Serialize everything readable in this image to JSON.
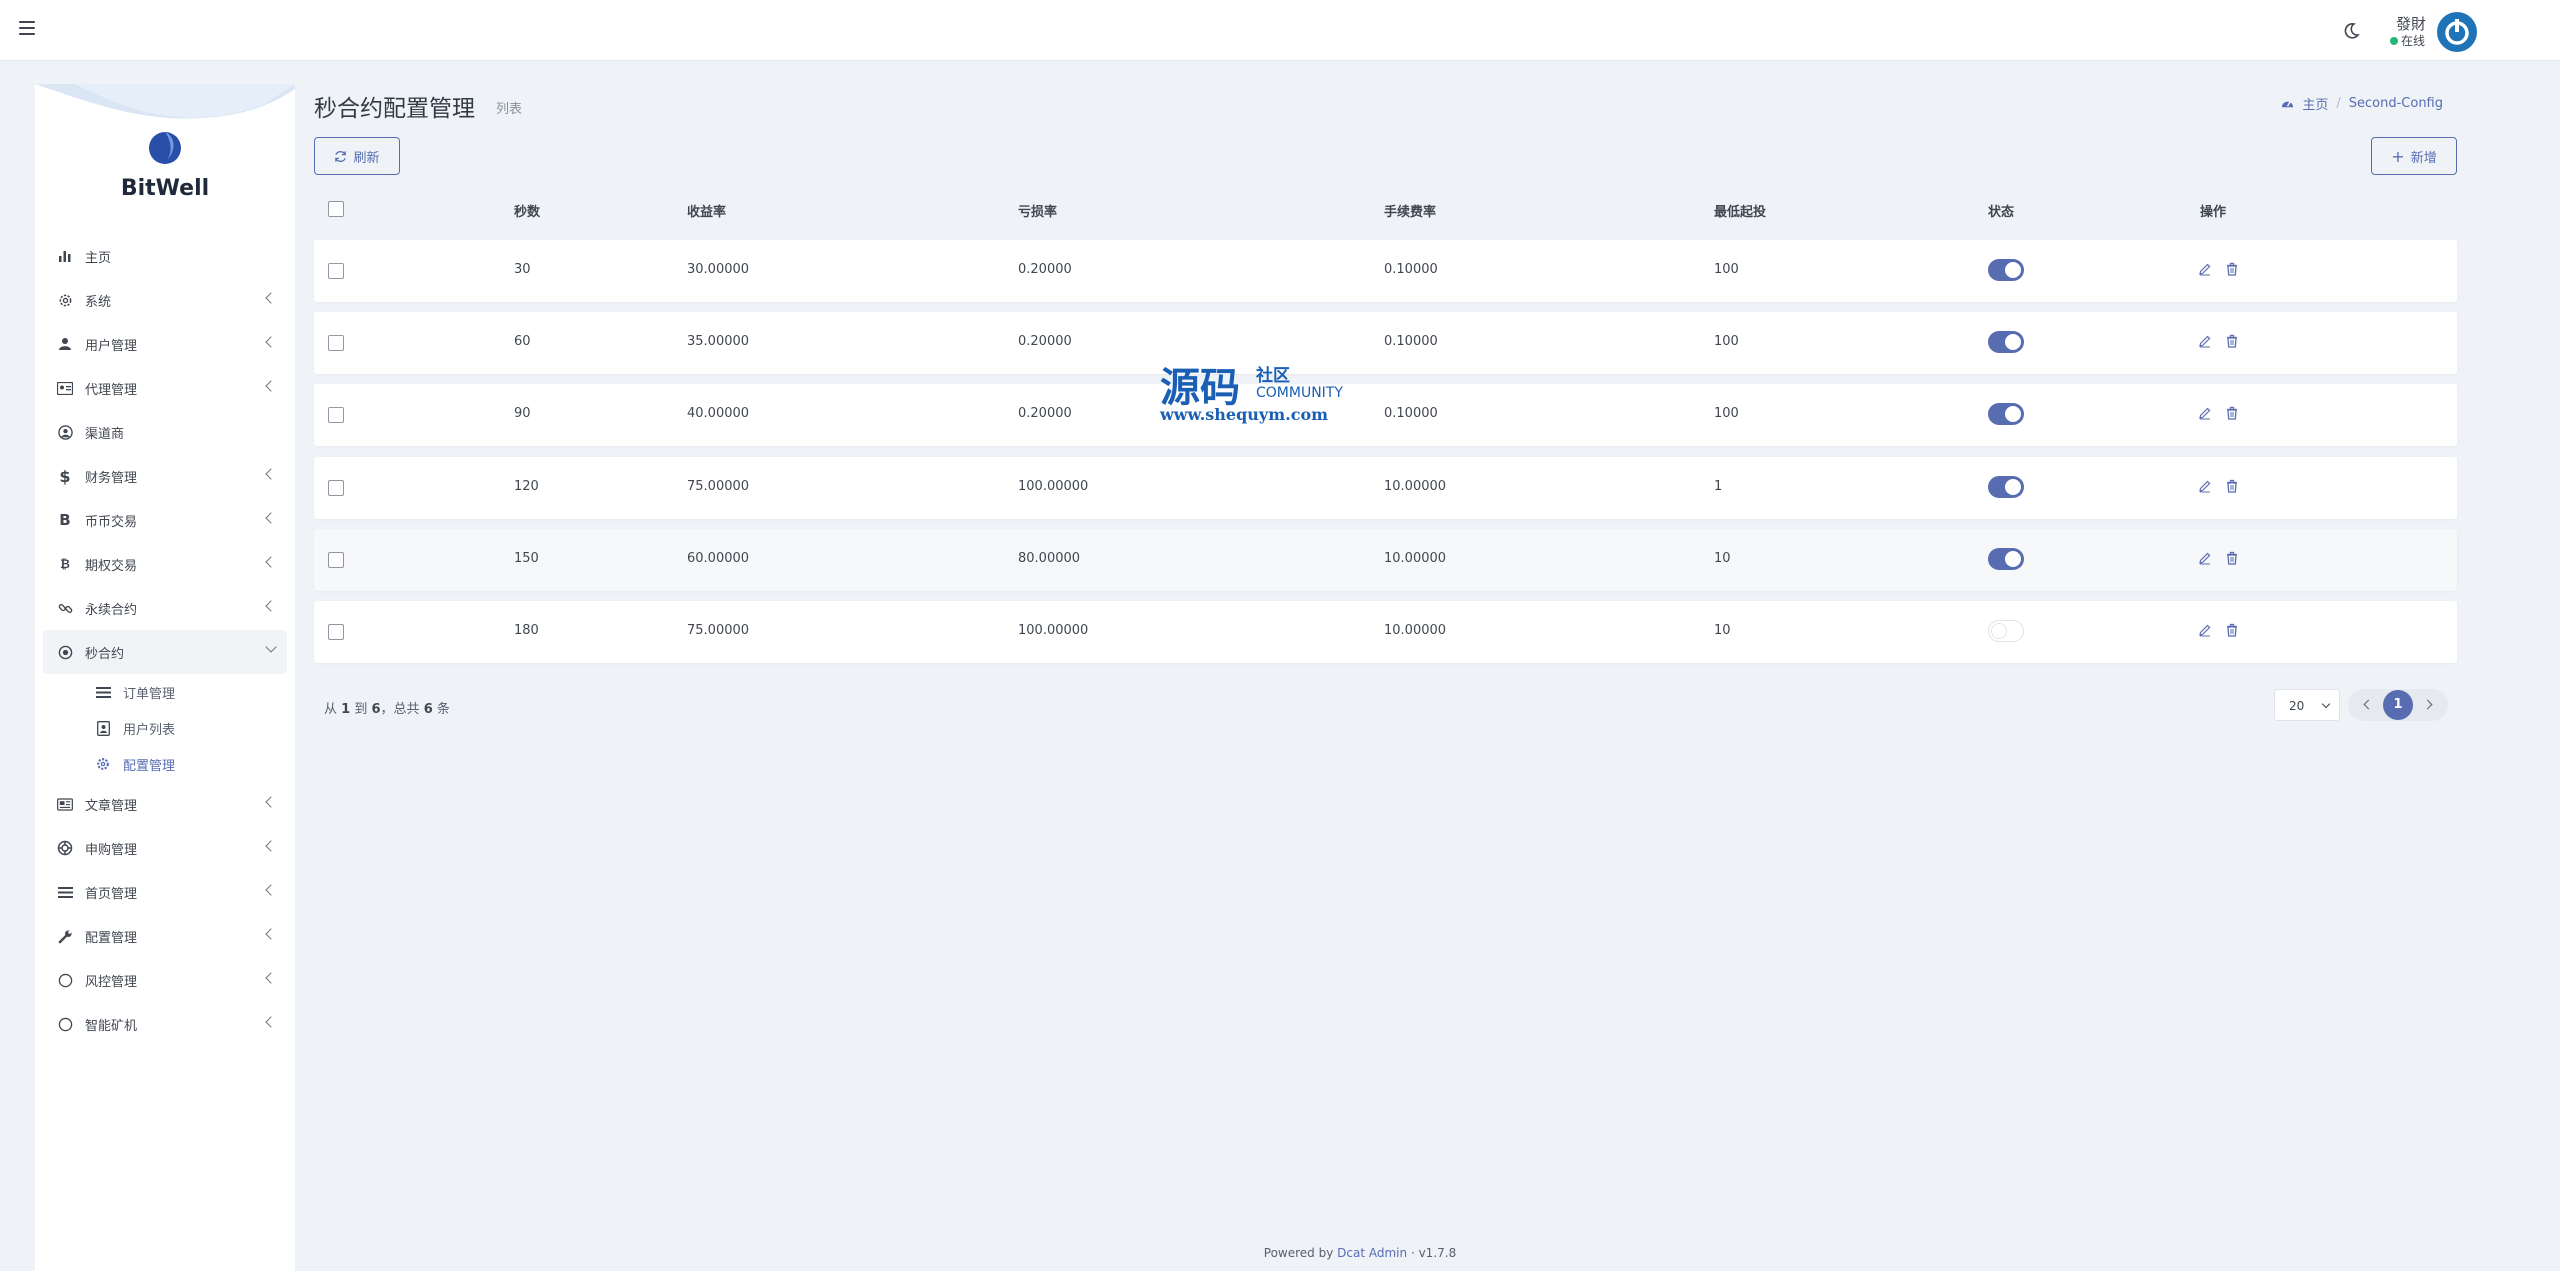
{
  "header": {
    "user_name": "發財",
    "user_status": "在线"
  },
  "sidebar": {
    "brand": "BitWell",
    "items": [
      {
        "label": "主页",
        "icon": "bar-chart-icon",
        "has_children": false
      },
      {
        "label": "系统",
        "icon": "gear-icon",
        "has_children": true
      },
      {
        "label": "用户管理",
        "icon": "user-icon",
        "has_children": true
      },
      {
        "label": "代理管理",
        "icon": "id-card-icon",
        "has_children": true
      },
      {
        "label": "渠道商",
        "icon": "user-circle-icon",
        "has_children": false
      },
      {
        "label": "财务管理",
        "icon": "dollar-icon",
        "has_children": true
      },
      {
        "label": "币币交易",
        "icon": "bitcoin-icon",
        "has_children": true
      },
      {
        "label": "期权交易",
        "icon": "bitcoin-circle-icon",
        "has_children": true
      },
      {
        "label": "永续合约",
        "icon": "link-icon",
        "has_children": true
      },
      {
        "label": "秒合约",
        "icon": "dot-circle-icon",
        "has_children": true,
        "expanded": true,
        "children": [
          {
            "label": "订单管理",
            "icon": "list-icon"
          },
          {
            "label": "用户列表",
            "icon": "user-square-icon"
          },
          {
            "label": "配置管理",
            "icon": "cog-icon",
            "active": true
          }
        ]
      },
      {
        "label": "文章管理",
        "icon": "newspaper-icon",
        "has_children": true
      },
      {
        "label": "申购管理",
        "icon": "life-ring-icon",
        "has_children": true
      },
      {
        "label": "首页管理",
        "icon": "list-icon",
        "has_children": true
      },
      {
        "label": "配置管理",
        "icon": "wrench-icon",
        "has_children": true
      },
      {
        "label": "风控管理",
        "icon": "circle-icon",
        "has_children": true
      },
      {
        "label": "智能矿机",
        "icon": "circle-icon",
        "has_children": true
      }
    ]
  },
  "page": {
    "title": "秒合约配置管理",
    "subtitle": "列表",
    "breadcrumb_home": "主页",
    "breadcrumb_current": "Second-Config",
    "refresh_label": "刷新",
    "new_label": "新增"
  },
  "table": {
    "columns": [
      "秒数",
      "收益率",
      "亏损率",
      "手续费率",
      "最低起投",
      "状态",
      "操作"
    ],
    "rows": [
      {
        "seconds": "30",
        "profit_rate": "30.00000",
        "loss_rate": "0.20000",
        "fee_rate": "0.10000",
        "min_invest": "100",
        "status_on": true
      },
      {
        "seconds": "60",
        "profit_rate": "35.00000",
        "loss_rate": "0.20000",
        "fee_rate": "0.10000",
        "min_invest": "100",
        "status_on": true
      },
      {
        "seconds": "90",
        "profit_rate": "40.00000",
        "loss_rate": "0.20000",
        "fee_rate": "0.10000",
        "min_invest": "100",
        "status_on": true
      },
      {
        "seconds": "120",
        "profit_rate": "75.00000",
        "loss_rate": "100.00000",
        "fee_rate": "10.00000",
        "min_invest": "1",
        "status_on": true
      },
      {
        "seconds": "150",
        "profit_rate": "60.00000",
        "loss_rate": "80.00000",
        "fee_rate": "10.00000",
        "min_invest": "10",
        "status_on": true
      },
      {
        "seconds": "180",
        "profit_rate": "75.00000",
        "loss_rate": "100.00000",
        "fee_rate": "10.00000",
        "min_invest": "10",
        "status_on": false
      }
    ]
  },
  "pagination": {
    "summary_from": "从",
    "summary_start": "1",
    "summary_to": "到",
    "summary_end": "6",
    "summary_total_pre": "，总共",
    "summary_total": "6",
    "summary_unit": "条",
    "per_page": "20",
    "current_page": "1"
  },
  "footer": {
    "powered_by": "Powered by",
    "link": "Dcat Admin",
    "version": "· v1.7.8"
  },
  "watermark": {
    "big": "源码",
    "small": "社区",
    "community": "COMMUNITY",
    "url": "www.shequym.com"
  },
  "colors": {
    "primary": "#586cb1",
    "background": "#eff3f8",
    "online": "#21b978",
    "avatar": "#1f73b7"
  }
}
